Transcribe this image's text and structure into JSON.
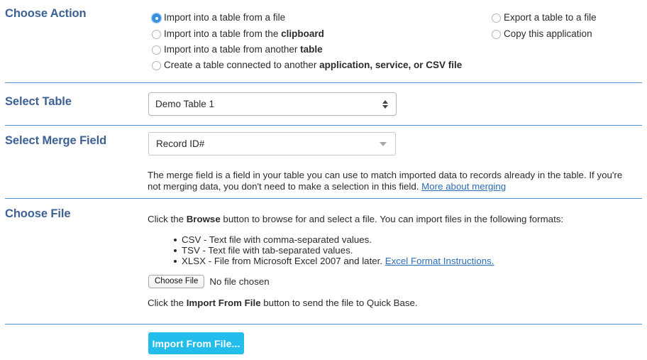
{
  "sections": {
    "choose_action": {
      "title": "Choose Action",
      "options_left": [
        {
          "label_plain": "Import into a table from a file",
          "label_bold": "",
          "checked": true
        },
        {
          "label_plain": "Import into a table from the ",
          "label_bold": "clipboard",
          "checked": false
        },
        {
          "label_plain": "Import into a table from another ",
          "label_bold": "table",
          "checked": false
        },
        {
          "label_plain": "Create a table connected to another ",
          "label_bold": "application, service, or CSV file",
          "checked": false
        }
      ],
      "options_right": [
        {
          "label_plain": "Export a table to a file",
          "label_bold": "",
          "checked": false
        },
        {
          "label_plain": "Copy this application",
          "label_bold": "",
          "checked": false
        }
      ]
    },
    "select_table": {
      "title": "Select Table",
      "value": "Demo Table 1"
    },
    "select_merge_field": {
      "title": "Select Merge Field",
      "value": "Record ID#",
      "help_line1": "The merge field is a field in your table you can use to match imported data to records already in the table. If you're",
      "help_line2": "not merging data, you don't need to make a selection in this field. ",
      "help_link": "More about merging"
    },
    "choose_file": {
      "title": "Choose File",
      "intro_before": "Click the ",
      "intro_bold": "Browse",
      "intro_after": " button to browse for and select a file. You can import files in the following formats:",
      "formats": [
        {
          "text": "CSV - Text file with comma-separated values.",
          "link": ""
        },
        {
          "text": "TSV - Text file with tab-separated values.",
          "link": ""
        },
        {
          "text": "XLSX - File from Microsoft Excel 2007 and later. ",
          "link": "Excel Format Instructions."
        }
      ],
      "choose_file_button": "Choose File",
      "file_status": "No file chosen",
      "outro_before": "Click the ",
      "outro_bold": "Import From File",
      "outro_after": " button to send the file to Quick Base."
    }
  },
  "submit": {
    "label": "Import From File..."
  },
  "colors": {
    "heading": "#3d6195",
    "rule": "#4a90d9",
    "radio_selected": "#3b8ede",
    "link": "#2a6dba",
    "primary_button": "#22bdeb"
  }
}
